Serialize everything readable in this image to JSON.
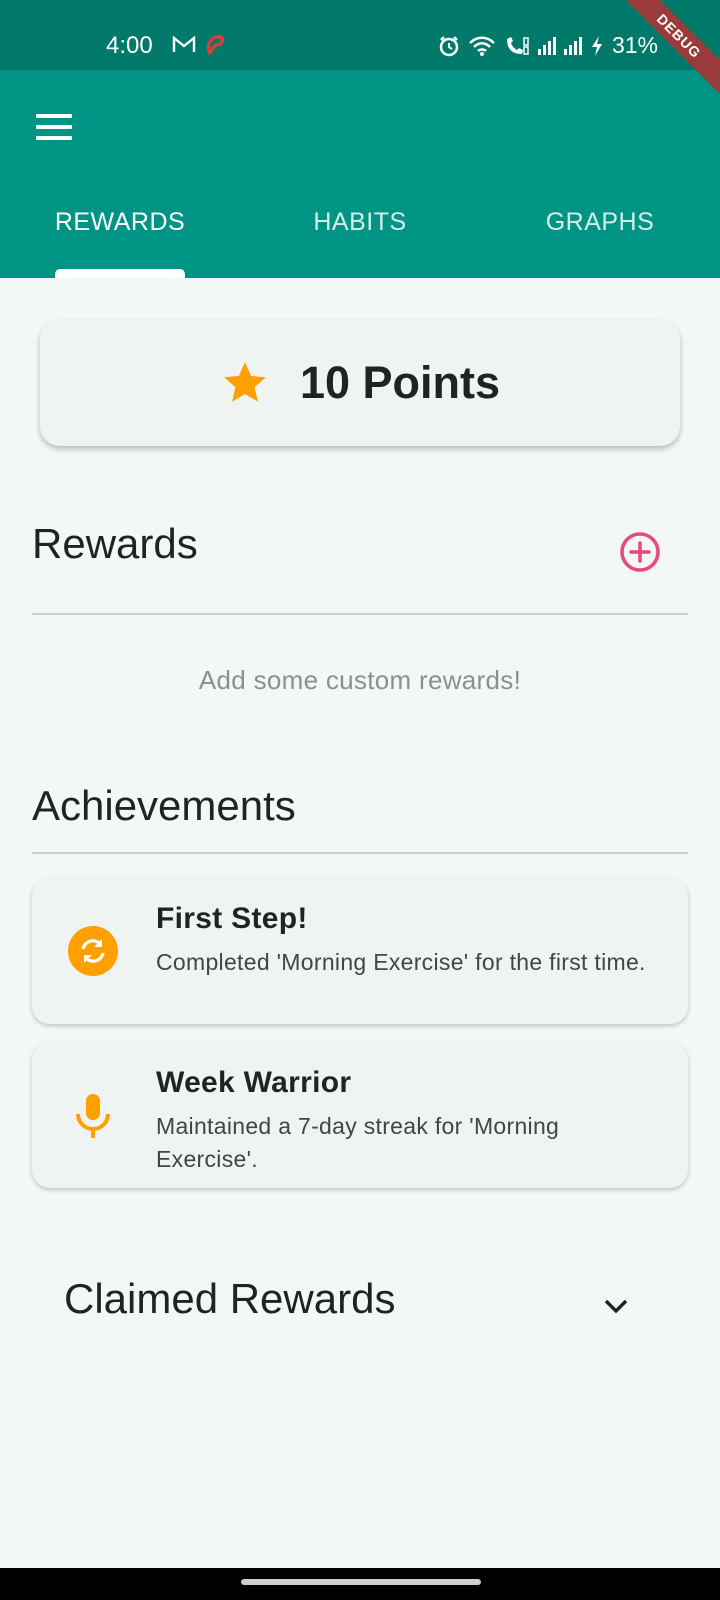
{
  "status_bar": {
    "time": "4:00",
    "battery": "31%"
  },
  "debug_banner": "DEBUG",
  "tabs": [
    {
      "label": "REWARDS",
      "active": true
    },
    {
      "label": "HABITS",
      "active": false
    },
    {
      "label": "GRAPHS",
      "active": false
    }
  ],
  "points": {
    "label": "10 Points",
    "icon": "star-icon"
  },
  "rewards": {
    "title": "Rewards",
    "empty_message": "Add some custom rewards!",
    "add_icon": "add-circle-icon"
  },
  "achievements": {
    "title": "Achievements",
    "items": [
      {
        "title": "First Step!",
        "description": "Completed 'Morning Exercise' for the first time.",
        "icon": "sync-icon"
      },
      {
        "title": "Week Warrior",
        "description": "Maintained a 7-day streak for 'Morning Exercise'.",
        "icon": "microphone-icon"
      }
    ]
  },
  "claimed_rewards": {
    "title": "Claimed Rewards",
    "toggle_icon": "chevron-down-icon"
  },
  "colors": {
    "app_bar": "#009485",
    "status_bar": "#00796b",
    "accent_orange": "#ff9f00",
    "accent_pink": "#e84a7f"
  }
}
